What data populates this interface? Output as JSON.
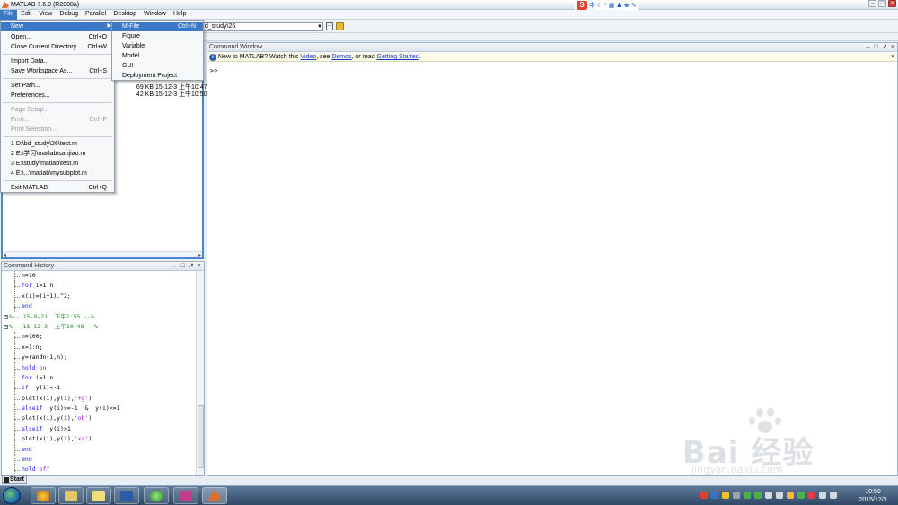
{
  "window": {
    "title": "MATLAB  7.6.0 (R2008a)"
  },
  "menubar": [
    "File",
    "Edit",
    "View",
    "Debug",
    "Parallel",
    "Desktop",
    "Window",
    "Help"
  ],
  "ime": {
    "logo": "S",
    "label": "中"
  },
  "toolbar": {
    "current_dir": "d_study\\26"
  },
  "file_menu": {
    "new": "New",
    "open": "Open...",
    "open_sc": "Ctrl+O",
    "close_dir": "Close Current Directory",
    "close_dir_sc": "Ctrl+W",
    "import": "Import Data...",
    "save_ws": "Save Workspace As...",
    "save_ws_sc": "Ctrl+S",
    "set_path": "Set Path...",
    "prefs": "Preferences...",
    "page_setup": "Page Setup...",
    "print": "Print...",
    "print_sc": "Ctrl+P",
    "print_sel": "Print Selection...",
    "recent1": "1 D:\\bd_study\\26\\test.m",
    "recent2": "2 E:\\学习\\matlab\\sanjiao.m",
    "recent3": "3 E:\\study\\matlab\\test.m",
    "recent4": "4 E:\\...\\matlab\\mysubplot.m",
    "exit": "Exit MATLAB",
    "exit_sc": "Ctrl+Q"
  },
  "new_submenu": {
    "mfile": "M-File",
    "mfile_sc": "Ctrl+N",
    "figure": "Figure",
    "variable": "Variable",
    "model": "Model",
    "gui": "GUI",
    "deploy": "Deployment Project"
  },
  "current_dir_rows": [
    {
      "size": "69 KB",
      "date": "15-12-3 上午10:47"
    },
    {
      "size": "42 KB",
      "date": "15-12-3 上午10:50"
    }
  ],
  "command_history": {
    "title": "Command History",
    "lines": [
      {
        "type": "code",
        "text": "n=10"
      },
      {
        "type": "code",
        "text": "for i=1:n"
      },
      {
        "type": "code",
        "text": "x(i)=(i+1).^2;"
      },
      {
        "type": "code",
        "text": "end"
      },
      {
        "type": "sect",
        "text": "%-- 15-9-21  下午1:55 --%"
      },
      {
        "type": "sect",
        "text": "%-- 15-12-3  上午10:48 --%"
      },
      {
        "type": "code",
        "text": "n=100;"
      },
      {
        "type": "code",
        "text": "x=1:n;"
      },
      {
        "type": "code",
        "text": "y=randn(1,n);"
      },
      {
        "type": "code",
        "text": "hold on"
      },
      {
        "type": "code",
        "text": "for i=1:n"
      },
      {
        "type": "code",
        "text": "if  y(i)<-1"
      },
      {
        "type": "code",
        "text": "plot(x(i),y(i),'+g')"
      },
      {
        "type": "code",
        "text": "elseif  y(i)>=-1  &  y(i)<=1"
      },
      {
        "type": "code",
        "text": "plot(x(i),y(i),'ob')"
      },
      {
        "type": "code",
        "text": "elseif  y(i)>1"
      },
      {
        "type": "code",
        "text": "plot(x(i),y(i),'xr')"
      },
      {
        "type": "code",
        "text": "end"
      },
      {
        "type": "code",
        "text": "end"
      },
      {
        "type": "code",
        "text": "hold off"
      }
    ]
  },
  "command_window": {
    "title": "Command Window",
    "info_prefix": "New to MATLAB? Watch this ",
    "link_video": "Video",
    "info_mid1": ", see ",
    "link_demos": "Demos",
    "info_mid2": ", or read ",
    "link_started": "Getting Started",
    "info_suffix": ".",
    "prompt": ">>"
  },
  "taskbar": {
    "start": "Start",
    "time": "10:50",
    "date": "2015/12/3"
  },
  "watermark": {
    "brand": "Bai  经验",
    "url": "jingyan.baidu.com"
  },
  "colors": {
    "accent": "#3b79c6",
    "keyword": "#1a1aff",
    "string": "#a020f0",
    "comment": "#228b22"
  }
}
